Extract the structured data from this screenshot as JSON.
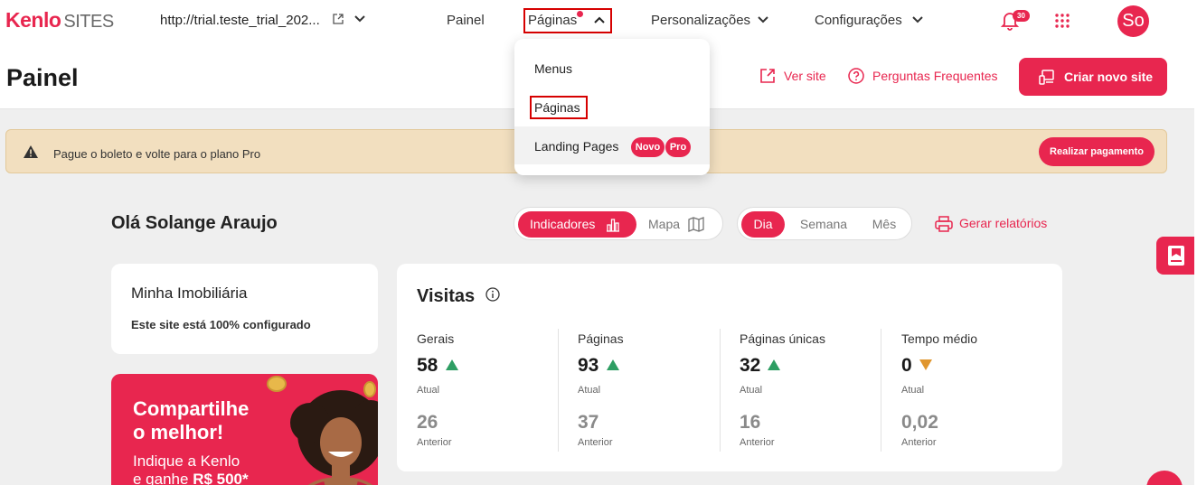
{
  "topbar": {
    "logo_brand": "Kenlo",
    "logo_product": "SITES",
    "site_url": "http://trial.teste_trial_202...",
    "nav": {
      "painel": "Painel",
      "paginas": "Páginas",
      "personalizacoes": "Personalizações",
      "configuracoes": "Configurações"
    },
    "notifications_count": "30",
    "avatar_initials": "So"
  },
  "header": {
    "title": "Painel",
    "ver_site": "Ver site",
    "faq": "Perguntas Frequentes",
    "create_site": "Criar novo site"
  },
  "alert": {
    "message": "Pague o boleto e volte para o plano Pro",
    "action": "Realizar pagamento"
  },
  "dashboard": {
    "greeting": "Olá Solange Araujo",
    "view_toggle": [
      "Indicadores",
      "Mapa"
    ],
    "period_toggle": [
      "Dia",
      "Semana",
      "Mês"
    ],
    "report": "Gerar relatórios"
  },
  "site_card": {
    "name": "Minha Imobiliária",
    "status": "Este site está 100% configurado"
  },
  "promo": {
    "headline_1": "Compartilhe",
    "headline_2": "o melhor!",
    "sub_1": "Indique a Kenlo",
    "sub_2_prefix": "e ganhe ",
    "sub_2_amount": "R$ 500*"
  },
  "visits": {
    "title": "Visitas",
    "current_caption": "Atual",
    "previous_caption": "Anterior",
    "metrics": [
      {
        "label": "Gerais",
        "current": "58",
        "previous": "26",
        "trend": "up"
      },
      {
        "label": "Páginas",
        "current": "93",
        "previous": "37",
        "trend": "up"
      },
      {
        "label": "Páginas únicas",
        "current": "32",
        "previous": "16",
        "trend": "up"
      },
      {
        "label": "Tempo médio",
        "current": "0",
        "previous": "0,02",
        "trend": "down"
      }
    ]
  },
  "dropdown": {
    "items": [
      "Menus",
      "Páginas",
      "Landing Pages"
    ],
    "badges": [
      "Novo",
      "Pro"
    ]
  },
  "colors": {
    "accent": "#e8264f",
    "trend_up": "#2e9e63",
    "trend_down": "#e0962e",
    "alert_bg": "#f2dfbf"
  }
}
